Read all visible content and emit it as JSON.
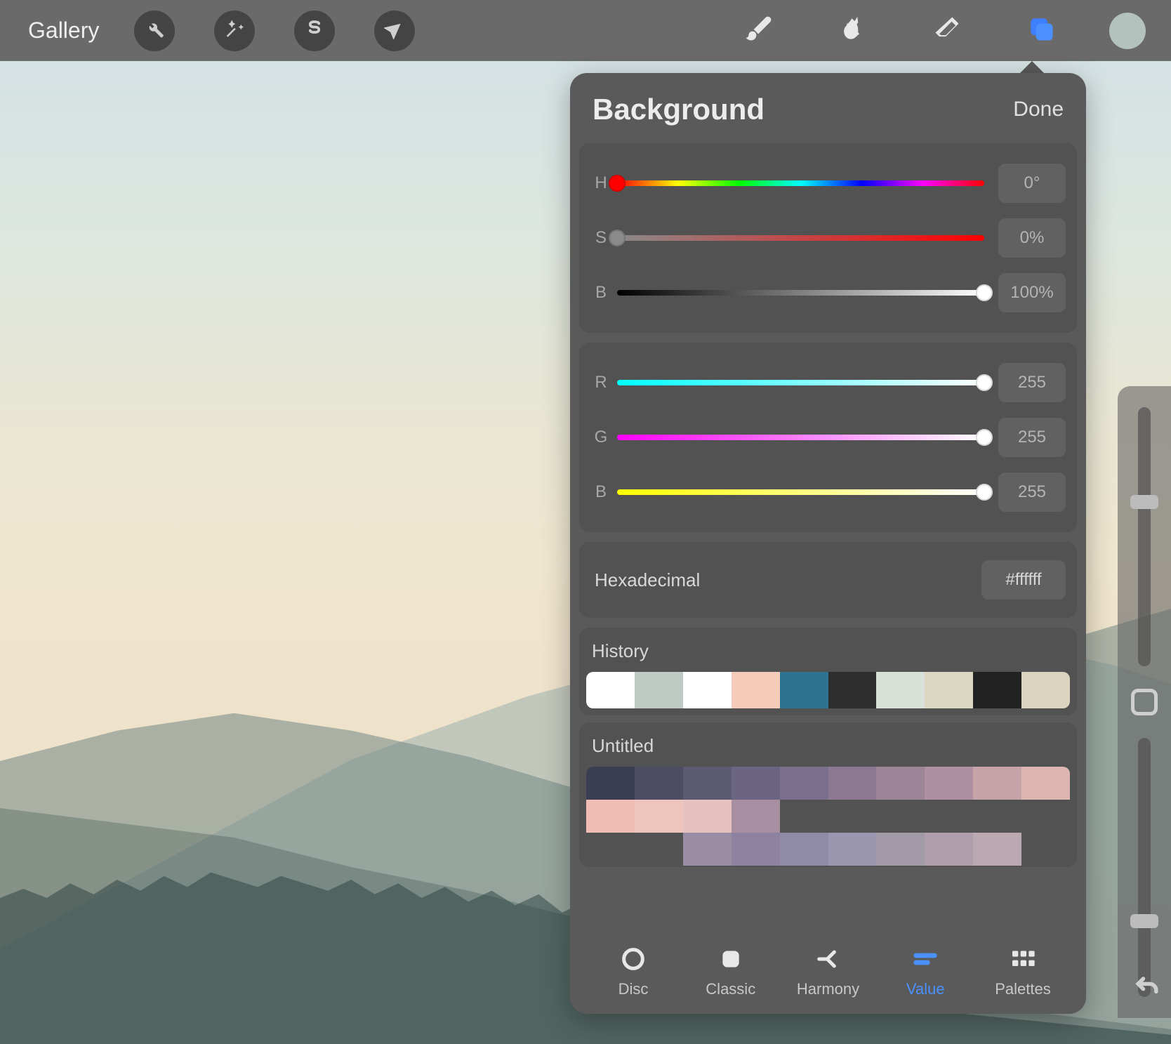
{
  "toolbar": {
    "gallery_label": "Gallery"
  },
  "panel": {
    "title": "Background",
    "done_label": "Done",
    "sliders": {
      "h": {
        "label": "H",
        "value": "0°",
        "pos": 0,
        "thumb": "#ff0000"
      },
      "s": {
        "label": "S",
        "value": "0%",
        "pos": 0,
        "thumb": "#8a8a8a"
      },
      "bri": {
        "label": "B",
        "value": "100%",
        "pos": 100,
        "thumb": "#ffffff"
      },
      "r": {
        "label": "R",
        "value": "255",
        "pos": 100,
        "thumb": "#ffffff"
      },
      "g": {
        "label": "G",
        "value": "255",
        "pos": 100,
        "thumb": "#ffffff"
      },
      "b": {
        "label": "B",
        "value": "255",
        "pos": 100,
        "thumb": "#ffffff"
      }
    },
    "hex_label": "Hexadecimal",
    "hex_value": "#ffffff",
    "history_label": "History",
    "history_colors": [
      "#ffffff",
      "#bfcac5",
      "#ffffff",
      "#f5ccb9",
      "#2e7292",
      "#2e2e2e",
      "#d9e0d7",
      "#dad6c1",
      "#222222",
      "#dcd4bf"
    ],
    "palette_name": "Untitled",
    "palette_rows": [
      [
        "#3b3e52",
        "#4c4c63",
        "#5c5a73",
        "#6c6483",
        "#7a6f8c",
        "#8c7892",
        "#9d8497",
        "#af90a0",
        "#c6a3a8",
        "#ddb6b2"
      ],
      [
        "#f0bdb4",
        "#eec5bc",
        "#e5c1c0",
        "#a78fa1",
        "",
        "",
        "",
        "",
        "",
        ""
      ],
      [
        "",
        "",
        "#9a8ca2",
        "#8d83a0",
        "#8f8aa6",
        "#9a96b0",
        "#a39aa8",
        "#af9fac",
        "#bca8b0",
        ""
      ]
    ],
    "tabs": [
      {
        "id": "disc",
        "label": "Disc"
      },
      {
        "id": "classic",
        "label": "Classic"
      },
      {
        "id": "harmony",
        "label": "Harmony"
      },
      {
        "id": "value",
        "label": "Value"
      },
      {
        "id": "palettes",
        "label": "Palettes"
      }
    ],
    "active_tab": "value"
  },
  "swatch_color": "#b3c2bd"
}
